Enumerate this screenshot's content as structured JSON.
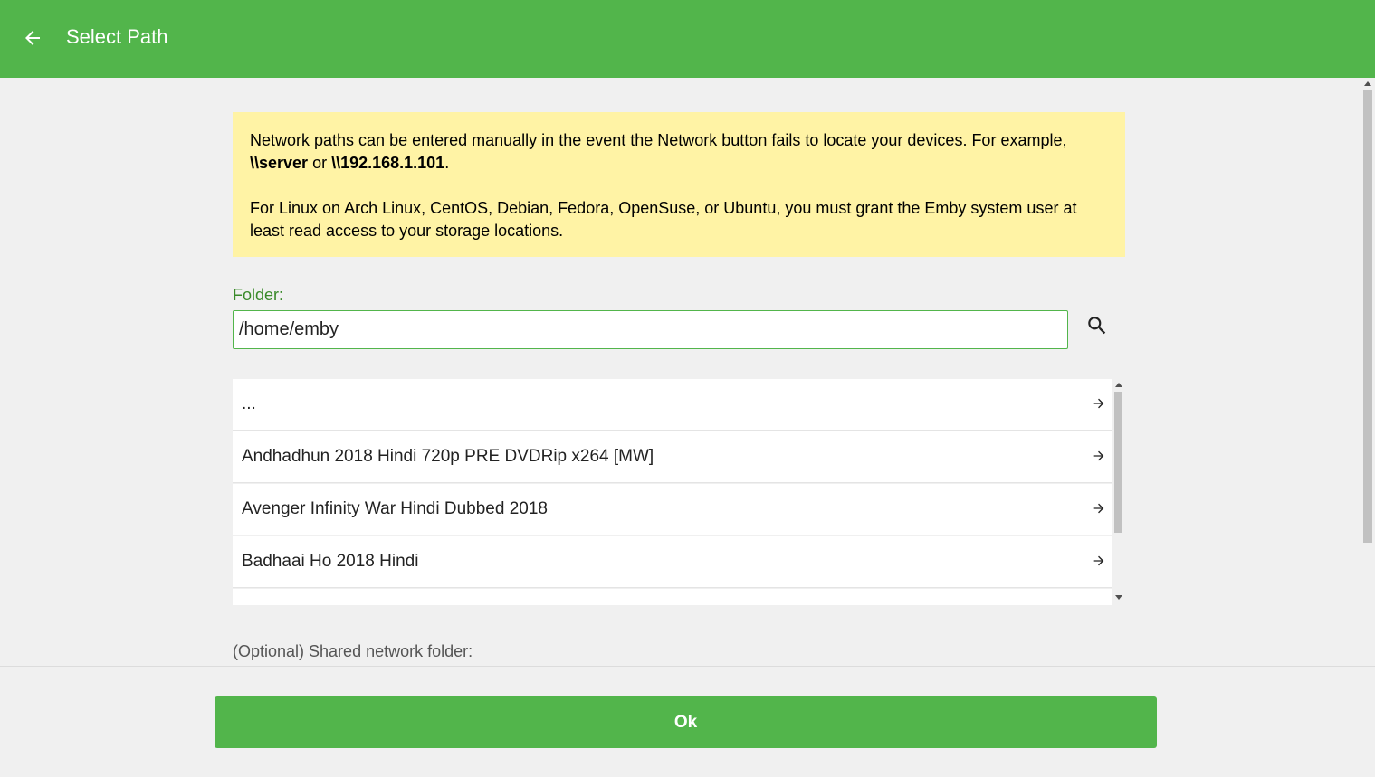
{
  "header": {
    "title": "Select Path",
    "background_color": "#52b54b",
    "back_icon": "arrow-left-icon"
  },
  "notice": {
    "line1_prefix": "Network paths can be entered manually in the event the Network button fails to locate your devices. For example, ",
    "example1": "\\\\server",
    "or_text": " or ",
    "example2": "\\\\192.168.1.101",
    "period": ".",
    "paragraph2": "For Linux on Arch Linux, CentOS, Debian, Fedora, OpenSuse, or Ubuntu, you must grant the Emby system user at least read access to your storage locations.",
    "background_color": "#fff3a5"
  },
  "folder": {
    "label": "Folder:",
    "value": "/home/emby",
    "search_icon": "search-icon"
  },
  "list": {
    "items": [
      {
        "label": "..."
      },
      {
        "label": "Andhadhun 2018 Hindi 720p PRE DVDRip x264 [MW]"
      },
      {
        "label": "Avenger Infinity War Hindi Dubbed 2018"
      },
      {
        "label": "Badhaai Ho 2018 Hindi"
      },
      {
        "label": ""
      }
    ],
    "item_icon": "arrow-right-icon"
  },
  "optional": {
    "label": "(Optional) Shared network folder:"
  },
  "footer": {
    "ok_label": "Ok",
    "button_color": "#52b54b"
  }
}
